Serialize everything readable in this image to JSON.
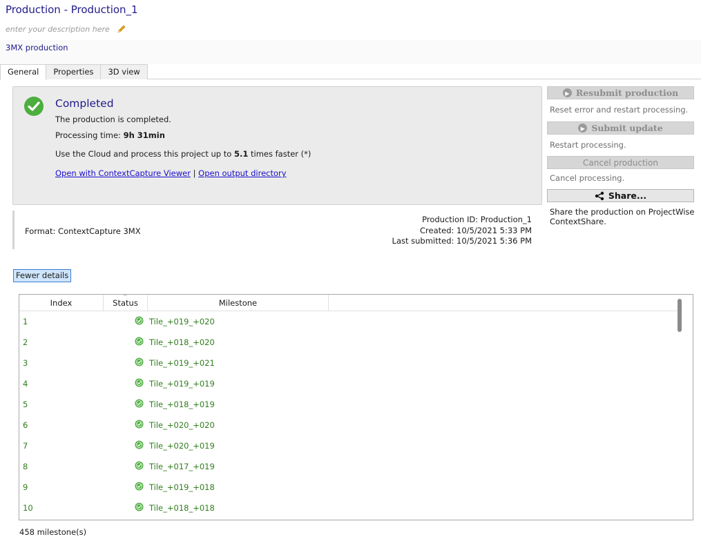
{
  "header": {
    "title": "Production - Production_1",
    "description_placeholder": "enter your description here",
    "production_type": "3MX production"
  },
  "tabs": [
    {
      "label": "General",
      "active": true
    },
    {
      "label": "Properties",
      "active": false
    },
    {
      "label": "3D view",
      "active": false
    }
  ],
  "status": {
    "title": "Completed",
    "message": "The production is completed.",
    "processing_label": "Processing time: ",
    "processing_time": "9h 31min",
    "cloud_pre": "Use the Cloud and process this project up to ",
    "cloud_factor": "5.1",
    "cloud_post": " times faster (*)",
    "link_viewer": "Open with ContextCapture Viewer",
    "link_separator": "|",
    "link_output": "Open output directory"
  },
  "info": {
    "format": "Format: ContextCapture 3MX",
    "production_id": "Production ID: Production_1",
    "created": "Created: 10/5/2021 5:33 PM",
    "last_submitted": "Last submitted: 10/5/2021 5:36 PM"
  },
  "actions": {
    "resubmit_label": "Resubmit production",
    "resubmit_desc": "Reset error and restart processing.",
    "submit_update_label": "Submit update",
    "submit_update_desc": "Restart processing.",
    "cancel_label": "Cancel production",
    "cancel_desc": "Cancel processing.",
    "share_label": "Share...",
    "share_desc": "Share the production on ProjectWise ContextShare."
  },
  "fewer_details_label": "Fewer details",
  "milestones": {
    "columns": [
      "Index",
      "Status",
      "Milestone"
    ],
    "rows": [
      {
        "index": "1",
        "milestone": "Tile_+019_+020"
      },
      {
        "index": "2",
        "milestone": "Tile_+018_+020"
      },
      {
        "index": "3",
        "milestone": "Tile_+019_+021"
      },
      {
        "index": "4",
        "milestone": "Tile_+019_+019"
      },
      {
        "index": "5",
        "milestone": "Tile_+018_+019"
      },
      {
        "index": "6",
        "milestone": "Tile_+020_+020"
      },
      {
        "index": "7",
        "milestone": "Tile_+020_+019"
      },
      {
        "index": "8",
        "milestone": "Tile_+017_+019"
      },
      {
        "index": "9",
        "milestone": "Tile_+019_+018"
      },
      {
        "index": "10",
        "milestone": "Tile_+018_+018"
      }
    ],
    "count_label": "458 milestone(s)"
  },
  "colors": {
    "accent": "#1f1a8a",
    "ok_green": "#4cae3e",
    "row_text": "#2f7d1b",
    "link": "#1a0dcc"
  }
}
